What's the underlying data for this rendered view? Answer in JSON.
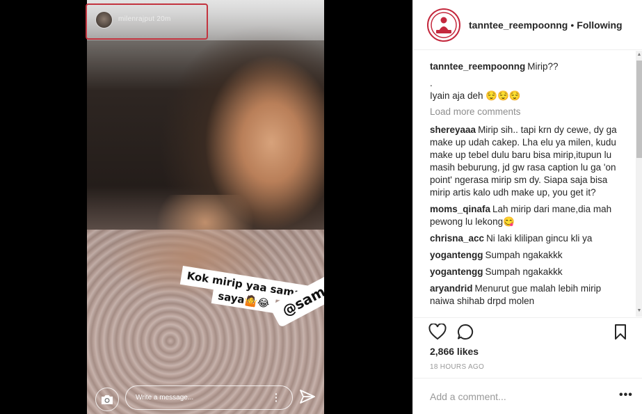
{
  "story": {
    "username": "milenrajput 20m",
    "sticker_line1": "Kok mirip yaa sama",
    "sticker_line2": "saya🤷😂",
    "mention": "@samanthakayty",
    "reply_placeholder": "Write a message...",
    "icons": [
      "camera-icon",
      "more-vertical-icon",
      "send-icon"
    ]
  },
  "post": {
    "username": "tanntee_reempoonng",
    "separator": "•",
    "follow_status": "Following",
    "caption": {
      "user": "tanntee_reempoonng",
      "text": "Mirip??",
      "line2": ".",
      "line3": "Iyain aja deh 😌😌😌"
    },
    "load_more": "Load more comments",
    "comments": [
      {
        "user": "shereyaaa",
        "text": "Mirip sih.. tapi krn dy cewe, dy ga make up udah cakep. Lha elu ya milen, kudu make up tebel dulu baru bisa mirip,itupun lu masih beburung, jd gw rasa caption lu ga 'on point' ngerasa mirip sm dy. Siapa saja bisa mirip artis kalo udh make up, you get it?"
      },
      {
        "user": "moms_qinafa",
        "text": "Lah mirip dari mane,dia mah pewong lu lekong😋"
      },
      {
        "user": "chrisna_acc",
        "text": "Ni laki klilipan gincu kli ya"
      },
      {
        "user": "yogantengg",
        "text": "Sumpah ngakakkk"
      },
      {
        "user": "yogantengg",
        "text": "Sumpah ngakakkk"
      },
      {
        "user": "aryandrid",
        "text": "Menurut gue malah lebih mirip naiwa shihab drpd molen"
      }
    ],
    "likes": "2,866 likes",
    "time": "18 HOURS AGO",
    "add_comment_placeholder": "Add a comment...",
    "more_label": "•••",
    "icons": [
      "heart-icon",
      "comment-icon",
      "bookmark-icon"
    ]
  },
  "colors": {
    "highlight_box": "#c3333e",
    "text": "#262626",
    "muted": "#8e8e8e",
    "brand_ring": "#c4283d"
  }
}
